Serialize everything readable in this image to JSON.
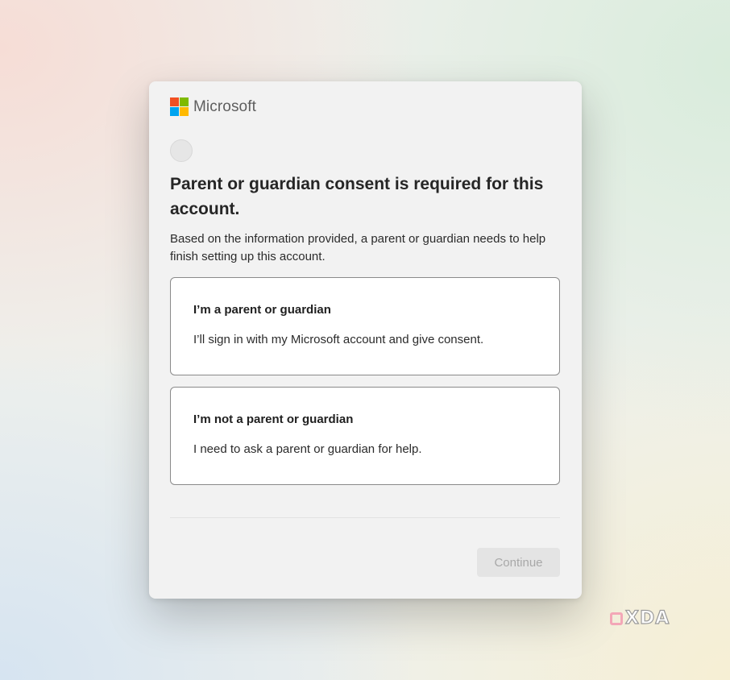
{
  "brand": {
    "name": "Microsoft",
    "logo_colors": [
      "#f25022",
      "#7fba00",
      "#00a4ef",
      "#ffb900"
    ]
  },
  "dialog": {
    "title": "Parent or guardian consent is required for this account.",
    "description": "Based on the information provided, a parent or guardian needs to help finish setting up this account."
  },
  "options": [
    {
      "title": "I’m a parent or guardian",
      "description": "I’ll sign in with my Microsoft account and give consent."
    },
    {
      "title": "I’m not a parent or guardian",
      "description": "I need to ask a parent or guardian for help."
    }
  ],
  "actions": {
    "continue_label": "Continue",
    "continue_enabled": false
  },
  "watermark": {
    "text": "XDA",
    "icon": "xda-logo-icon"
  }
}
